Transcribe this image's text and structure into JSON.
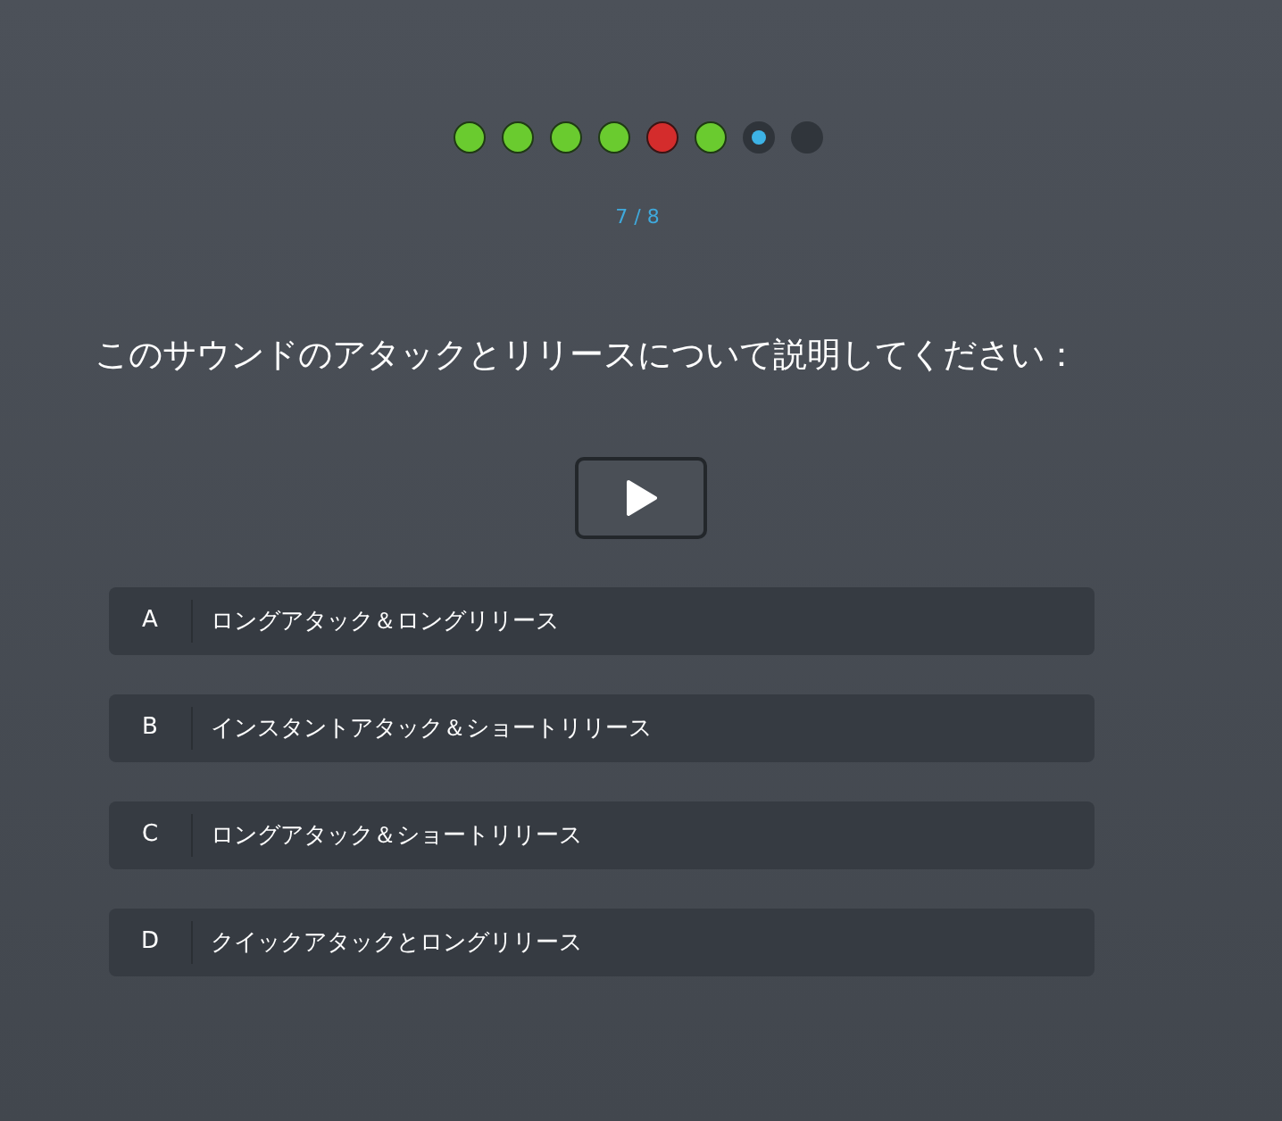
{
  "progress": [
    {
      "kind": "correct"
    },
    {
      "kind": "correct"
    },
    {
      "kind": "correct"
    },
    {
      "kind": "correct"
    },
    {
      "kind": "wrong"
    },
    {
      "kind": "correct"
    },
    {
      "kind": "current"
    },
    {
      "kind": "pending"
    }
  ],
  "counter": "7 / 8",
  "question": "このサウンドのアタックとリリースについて説明してください：",
  "options": [
    {
      "letter": "A",
      "text": "ロングアタック＆ロングリリース"
    },
    {
      "letter": "B",
      "text": "インスタントアタック＆ショートリリース"
    },
    {
      "letter": "C",
      "text": "ロングアタック＆ショートリリース"
    },
    {
      "letter": "D",
      "text": "クイックアタックとロングリリース"
    }
  ]
}
